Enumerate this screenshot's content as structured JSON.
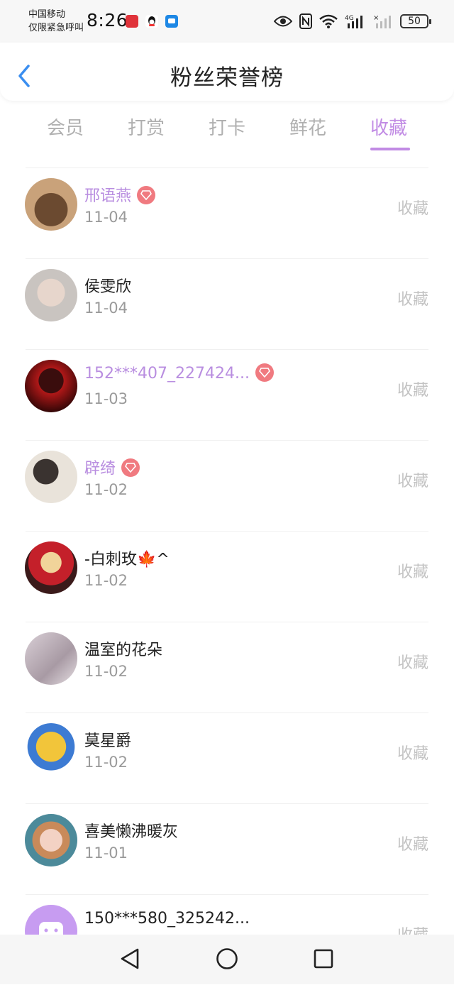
{
  "status_bar": {
    "carrier_line1": "中国移动",
    "carrier_line2": "仅限紧急呼叫",
    "time": "8:26",
    "battery": "50"
  },
  "header": {
    "title": "粉丝荣誉榜"
  },
  "tabs": [
    {
      "label": "会员"
    },
    {
      "label": "打赏"
    },
    {
      "label": "打卡"
    },
    {
      "label": "鲜花"
    },
    {
      "label": "收藏"
    }
  ],
  "active_tab": "收藏",
  "accent_color": "#c18be4",
  "fans": [
    {
      "name": "邢语燕",
      "date": "11-04",
      "action": "收藏",
      "vip": true
    },
    {
      "name": "侯雯欣",
      "date": "11-04",
      "action": "收藏",
      "vip": false
    },
    {
      "name": "152***407_227424...",
      "date": "11-03",
      "action": "收藏",
      "vip": true
    },
    {
      "name": "辟绮",
      "date": "11-02",
      "action": "收藏",
      "vip": true
    },
    {
      "name": "-白刺玫🍁^",
      "date": "11-02",
      "action": "收藏",
      "vip": false
    },
    {
      "name": "温室的花朵",
      "date": "11-02",
      "action": "收藏",
      "vip": false
    },
    {
      "name": "莫星爵",
      "date": "11-02",
      "action": "收藏",
      "vip": false
    },
    {
      "name": "喜美懒沸暖灰",
      "date": "11-01",
      "action": "收藏",
      "vip": false
    },
    {
      "name": "150***580_325242...",
      "date": "",
      "action": "收藏",
      "vip": false
    }
  ]
}
